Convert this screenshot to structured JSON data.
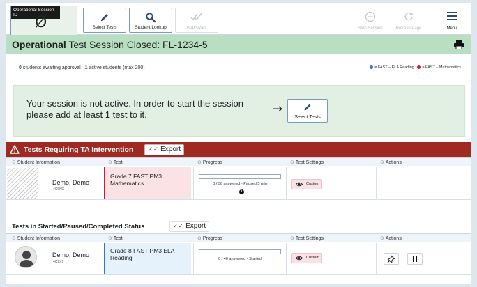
{
  "toolbar": {
    "session_label": "Operational Session ID",
    "session_id": "Ø",
    "select_tests": "Select Tests",
    "student_lookup": "Student Lookup",
    "approvals": "Approvals",
    "stop_session": "Stop Session",
    "refresh_page": "Refresh Page",
    "menu": "Menu"
  },
  "header": {
    "mode": "Operational",
    "title_rest": " Test Session Closed: FL-1234-5"
  },
  "status": {
    "awaiting_count": "0",
    "awaiting_text": " students awaiting approval",
    "active_count": "1",
    "active_text": " active students (max 200)",
    "legend_reading": "= FAST – ELA Reading",
    "legend_math": "= FAST – Mathematics"
  },
  "colors": {
    "reading": "#2d78c8",
    "math": "#c8202a",
    "alert": "#a02a22",
    "accent": "#2456a6"
  },
  "notice": {
    "message": "Your session is not active. In order to start the session please add at least 1 test to it.",
    "button": "Select Tests"
  },
  "export_label": "Export",
  "intervention": {
    "title": "Tests Requiring TA Intervention",
    "columns": [
      "Student Information",
      "Test",
      "Progress",
      "Test Settings",
      "Actions"
    ],
    "rows": [
      {
        "name": "Demo, Demo",
        "id": "4C9NX",
        "test": "Grade 7 FAST PM3 Mathematics",
        "progress_text": "0 / 36 answered  -  Paused  5 min",
        "progress_fraction": 0,
        "settings": "Custom"
      }
    ]
  },
  "started": {
    "title": "Tests in Started/Paused/Completed Status",
    "columns": [
      "Student Information",
      "Test",
      "Progress",
      "Test Settings",
      "Actions"
    ],
    "rows": [
      {
        "name": "Demo, Demo",
        "id": "4C9X1",
        "test": "Grade 8 FAST PM3 ELA Reading",
        "progress_text": "0 / 40 answered  -  Started",
        "progress_fraction": 0,
        "settings": "Custom"
      }
    ]
  },
  "icons": {
    "select_tests": "pencil-icon",
    "student_lookup": "magnifier-icon",
    "approvals": "double-check-icon",
    "stop_session": "stop-icon",
    "refresh_page": "refresh-icon",
    "menu": "hamburger-icon",
    "print": "printer-icon",
    "warning": "warning-icon",
    "pause": "pause-icon",
    "pin": "pin-icon",
    "eye": "eye-icon"
  }
}
